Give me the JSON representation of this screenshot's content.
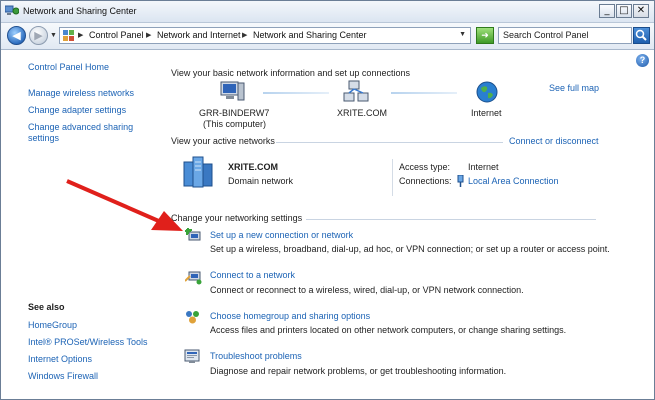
{
  "window": {
    "title": "Network and Sharing Center",
    "controls": {
      "minimize": "_",
      "maximize": "□",
      "close": "✕"
    }
  },
  "navbar": {
    "breadcrumbs": [
      "Control Panel",
      "Network and Internet",
      "Network and Sharing Center"
    ],
    "search_placeholder": "Search Control Panel"
  },
  "sidebar": {
    "home": "Control Panel Home",
    "tasks": [
      "Manage wireless networks",
      "Change adapter settings",
      "Change advanced sharing settings"
    ],
    "see_also_heading": "See also",
    "see_also": [
      "HomeGroup",
      "Intel® PROSet/Wireless Tools",
      "Internet Options",
      "Windows Firewall"
    ]
  },
  "map": {
    "heading": "View your basic network information and set up connections",
    "see_full_map": "See full map",
    "nodes": [
      {
        "label": "GRR-BINDERW7",
        "sub": "(This computer)",
        "icon": "computer-icon"
      },
      {
        "label": "XRITE.COM",
        "sub": "",
        "icon": "network-icon"
      },
      {
        "label": "Internet",
        "sub": "",
        "icon": "globe-icon"
      }
    ]
  },
  "active": {
    "heading": "View your active networks",
    "connect_link": "Connect or disconnect",
    "network_name": "XRITE.COM",
    "network_type": "Domain network",
    "access_type_label": "Access type:",
    "access_type_value": "Internet",
    "connections_label": "Connections:",
    "connections_value": "Local Area Connection"
  },
  "settings": {
    "heading": "Change your networking settings",
    "tasks": [
      {
        "title": "Set up a new connection or network",
        "desc": "Set up a wireless, broadband, dial-up, ad hoc, or VPN connection; or set up a router or access point.",
        "icon": "new-connection-icon"
      },
      {
        "title": "Connect to a network",
        "desc": "Connect or reconnect to a wireless, wired, dial-up, or VPN network connection.",
        "icon": "connect-icon"
      },
      {
        "title": "Choose homegroup and sharing options",
        "desc": "Access files and printers located on other network computers, or change sharing settings.",
        "icon": "homegroup-icon"
      },
      {
        "title": "Troubleshoot problems",
        "desc": "Diagnose and repair network problems, or get troubleshooting information.",
        "icon": "troubleshoot-icon"
      }
    ]
  },
  "colors": {
    "link": "#1c63b5",
    "annotation_arrow": "#e0201b"
  }
}
